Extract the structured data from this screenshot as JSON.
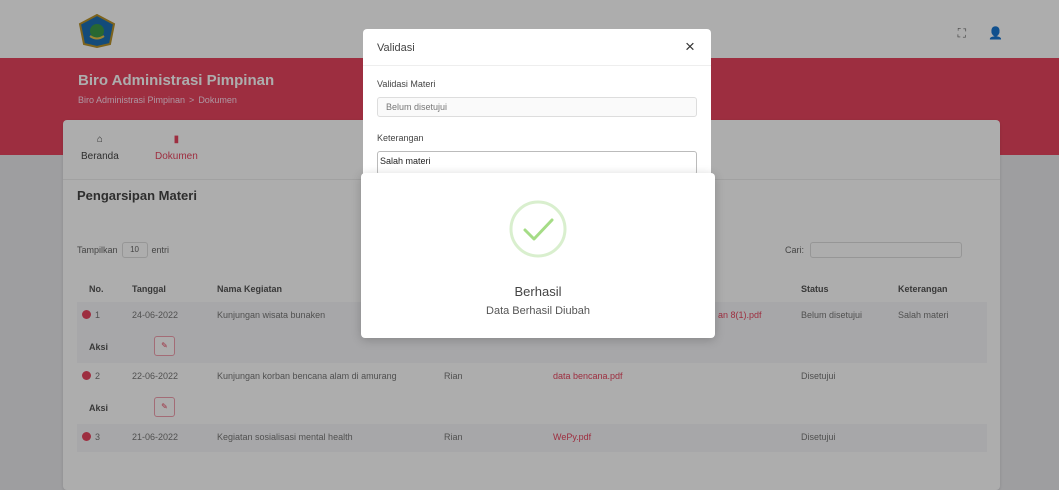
{
  "app": {
    "title": "Biro Administrasi Pimpinan",
    "breadcrumb": [
      "Biro Administrasi Pimpinan",
      "Dokumen"
    ],
    "breadcrumb_separator": ">"
  },
  "nav": {
    "home_label": "Beranda",
    "docs_label": "Dokumen"
  },
  "section_title": "Pengarsipan Materi",
  "table_controls": {
    "show_label": "Tampilkan",
    "entries_value": "10",
    "entries_label": "entri",
    "search_label": "Cari:"
  },
  "table": {
    "headers": [
      "No.",
      "Tanggal",
      "Nama Kegiatan",
      "Status",
      "Keterangan"
    ],
    "rows": [
      {
        "no": "1",
        "date": "24-06-2022",
        "activity": "Kunjungan wisata bunaken",
        "name": "",
        "file": "an 8(1).pdf",
        "status": "Belum disetujui",
        "note": "Salah materi"
      },
      {
        "no": "2",
        "date": "22-06-2022",
        "activity": "Kunjungan korban bencana alam di amurang",
        "name": "Rian",
        "file": "data bencana.pdf",
        "status": "Disetujui",
        "note": ""
      },
      {
        "no": "3",
        "date": "21-06-2022",
        "activity": "Kegiatan sosialisasi mental health",
        "name": "Rian",
        "file": "WePy.pdf",
        "status": "Disetujui",
        "note": ""
      }
    ],
    "aksi_label": "Aksi"
  },
  "modal": {
    "title": "Validasi",
    "close_symbol": "×",
    "field1_label": "Validasi Materi",
    "field1_value": "Belum disetujui",
    "field2_label": "Keterangan",
    "field2_value": "Salah materi"
  },
  "alert": {
    "title": "Berhasil",
    "text": "Data Berhasil Diubah"
  },
  "colors": {
    "brand": "#e8455f",
    "success": "#a5dc86"
  },
  "icons": {
    "fullscreen": "fullscreen-icon",
    "user": "user-icon",
    "home": "home-icon",
    "document": "document-icon",
    "edit": "edit-icon",
    "success": "checkmark-icon"
  }
}
